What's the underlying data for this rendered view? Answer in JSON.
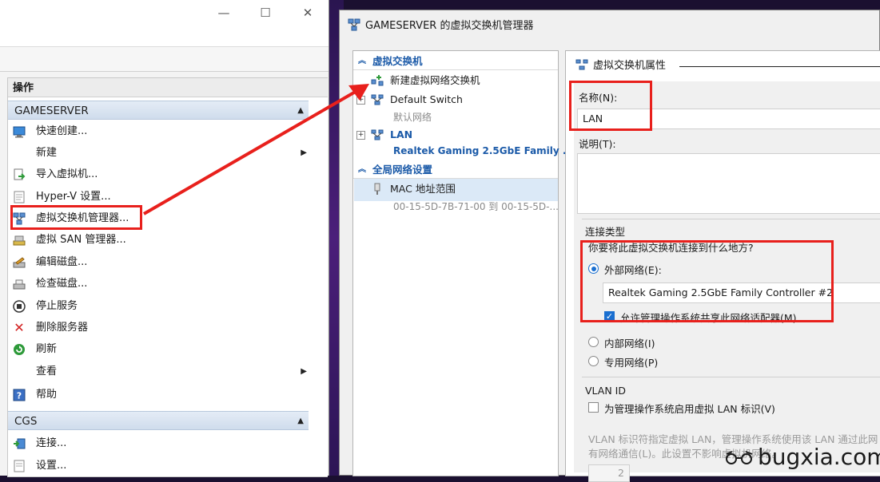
{
  "left_window": {
    "controls": {
      "minimize": "—",
      "maximize": "☐",
      "close": "✕"
    },
    "actions_header": "操作",
    "section_gameserver": "GAMESERVER",
    "items": [
      {
        "label": "快速创建...",
        "icon": "quick-create-icon"
      },
      {
        "label": "新建",
        "icon": "",
        "submenu": "▶"
      },
      {
        "label": "导入虚拟机...",
        "icon": "import-vm-icon"
      },
      {
        "label": "Hyper-V 设置...",
        "icon": "settings-page-icon"
      },
      {
        "label": "虚拟交换机管理器...",
        "icon": "virtual-switch-icon"
      },
      {
        "label": "虚拟 SAN 管理器...",
        "icon": "san-icon"
      },
      {
        "label": "编辑磁盘...",
        "icon": "edit-disk-icon"
      },
      {
        "label": "检查磁盘...",
        "icon": "inspect-disk-icon"
      },
      {
        "label": "停止服务",
        "icon": "stop-icon"
      },
      {
        "label": "删除服务器",
        "icon": "delete-icon"
      },
      {
        "label": "刷新",
        "icon": "refresh-icon"
      },
      {
        "label": "查看",
        "icon": "",
        "submenu": "▶"
      },
      {
        "label": "帮助",
        "icon": "help-icon"
      }
    ],
    "section_cgs": "CGS",
    "cgs_items": [
      {
        "label": "连接...",
        "icon": "connect-icon"
      },
      {
        "label": "设置...",
        "icon": "settings-icon"
      }
    ]
  },
  "dialog": {
    "title": "GAMESERVER 的虚拟交换机管理器",
    "tree": {
      "virtual_switches_header": "虚拟交换机",
      "new_switch": "新建虚拟网络交换机",
      "default_switch": "Default Switch",
      "default_switch_sub": "默认网络",
      "lan": "LAN",
      "lan_sub": "Realtek Gaming 2.5GbE Family ...",
      "global_header": "全局网络设置",
      "mac_range": "MAC 地址范围",
      "mac_range_sub": "00-15-5D-7B-71-00 到 00-15-5D-..."
    },
    "props": {
      "header": "虚拟交换机属性",
      "name_label": "名称(N):",
      "name_value": "LAN",
      "notes_label": "说明(T):",
      "conn_type_label": "连接类型",
      "conn_question": "你要将此虚拟交换机连接到什么地方?",
      "external_label": "外部网络(E):",
      "adapter_value": "Realtek Gaming 2.5GbE Family Controller #2",
      "allow_mgmt_label": "允许管理操作系统共享此网络适配器(M)",
      "internal_label": "内部网络(I)",
      "private_label": "专用网络(P)",
      "vlan_header": "VLAN ID",
      "vlan_enable_label": "为管理操作系统启用虚拟 LAN 标识(V)",
      "vlan_desc_1": "VLAN 标识符指定虚拟 LAN，管理操作系统使用该 LAN 通过此网",
      "vlan_desc_2": "有网络通信(L)。此设置不影响虚拟机网络。",
      "vlan_value": "2"
    }
  },
  "watermark": "bugxia.com",
  "colors": {
    "annotation_red": "#e8201c",
    "link_blue": "#1b5aa8",
    "accent_blue": "#1a6fd0",
    "selection": "#dbe9f7"
  }
}
